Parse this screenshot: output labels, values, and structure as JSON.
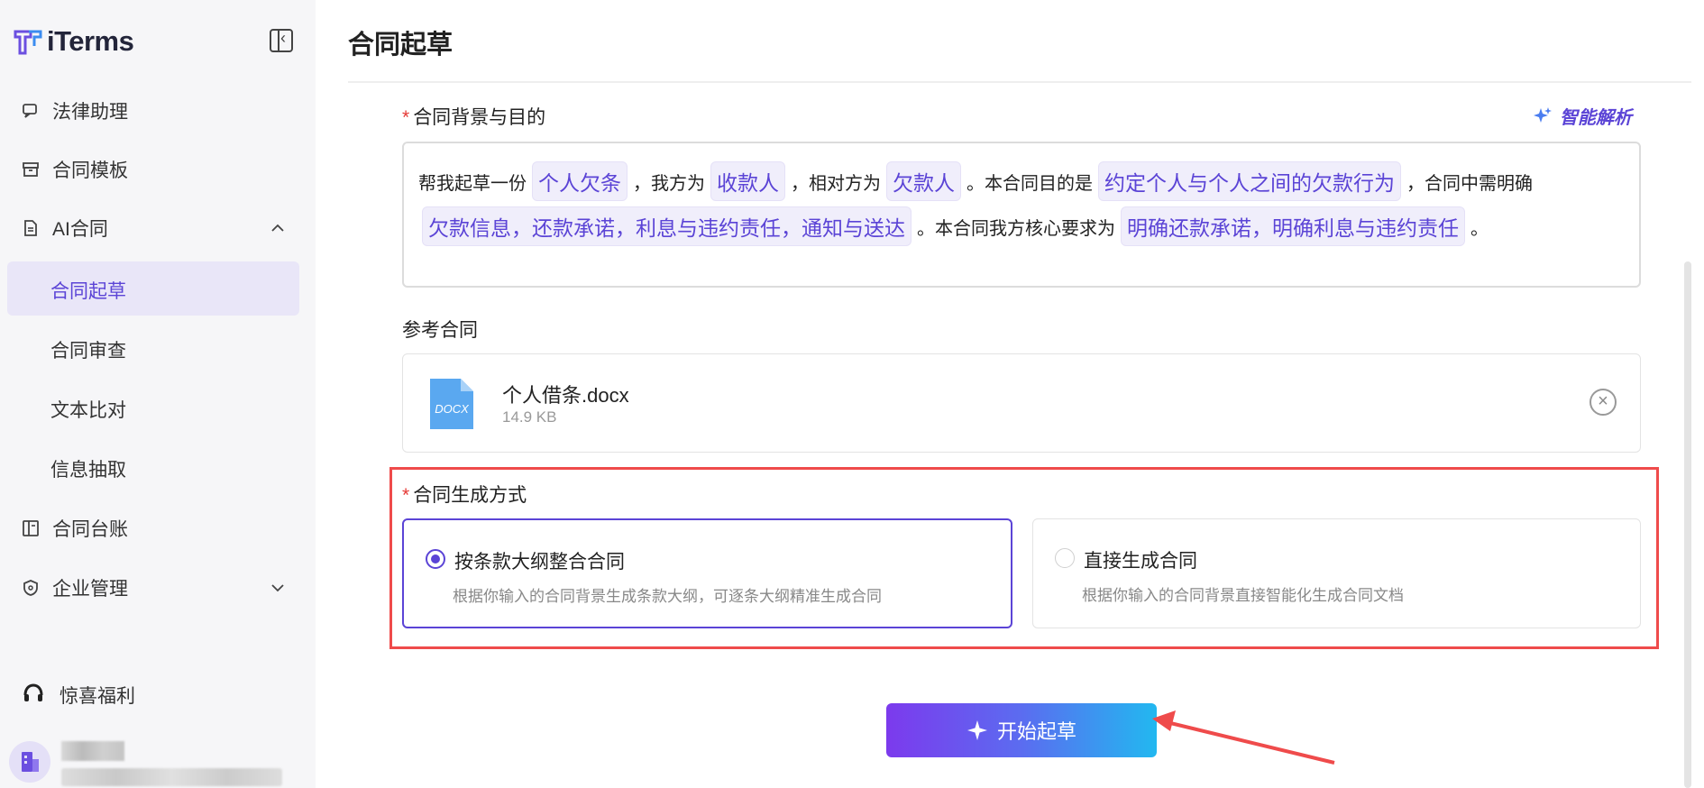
{
  "sidebar": {
    "logo": "iTerms",
    "items": [
      {
        "label": "法律助理"
      },
      {
        "label": "合同模板"
      },
      {
        "label": "AI合同"
      },
      {
        "label": "合同起草"
      },
      {
        "label": "合同审查"
      },
      {
        "label": "文本比对"
      },
      {
        "label": "信息抽取"
      },
      {
        "label": "合同台账"
      },
      {
        "label": "企业管理"
      }
    ],
    "gift": "惊喜福利"
  },
  "page": {
    "title": "合同起草"
  },
  "background": {
    "label": "合同背景与目的",
    "smart_parse": "智能解析",
    "t1": "帮我起草一份",
    "chip1": "个人欠条",
    "t2": "，我方为",
    "chip2": "收款人",
    "t3": "，相对方为",
    "chip3": "欠款人",
    "t4": "。本合同目的是",
    "chip4": "约定个人与个人之间的欠款行为",
    "t5": "，合同中需明确",
    "chip5": "欠款信息，还款承诺，利息与违约责任，通知与送达",
    "t6": "。本合同我方核心要求为",
    "chip6": "明确还款承诺，明确利息与违约责任",
    "t7": "。"
  },
  "reference": {
    "label": "参考合同",
    "icon_text": "DOCX",
    "file_name": "个人借条.docx",
    "file_size": "14.9 KB"
  },
  "generation": {
    "label": "合同生成方式",
    "options": [
      {
        "title": "按条款大纲整合合同",
        "desc": "根据你输入的合同背景生成条款大纲，可逐条大纲精准生成合同",
        "selected": true
      },
      {
        "title": "直接生成合同",
        "desc": "根据你输入的合同背景直接智能化生成合同文档",
        "selected": false
      }
    ]
  },
  "start_button": "开始起草",
  "colors": {
    "accent": "#5b44d6",
    "highlight": "#ef4b4b"
  }
}
